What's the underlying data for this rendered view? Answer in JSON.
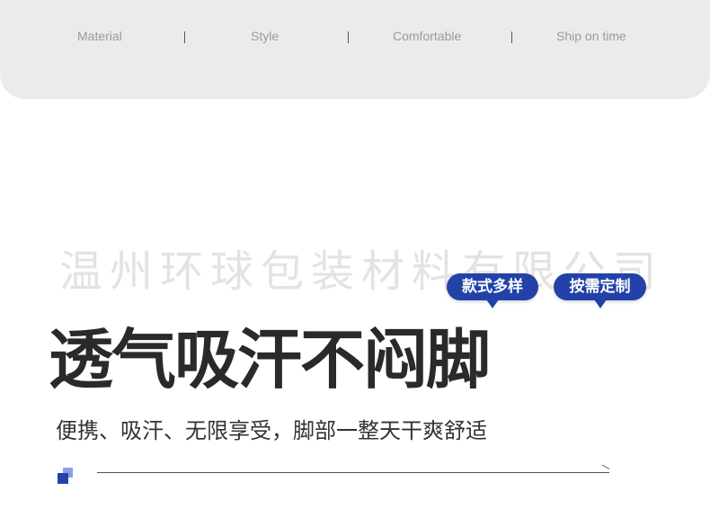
{
  "tabs": [
    "Material",
    "Style",
    "Comfortable",
    "Ship on time"
  ],
  "watermark": "温州环球包装材料有限公司",
  "badges": [
    "款式多样",
    "按需定制"
  ],
  "headline": "透气吸汗不闷脚",
  "subline": "便携、吸汗、无限享受，脚部一整天干爽舒适",
  "colors": {
    "accent": "#2342a8",
    "topbar_bg": "#ebebeb",
    "headline": "#2a2a2a"
  }
}
